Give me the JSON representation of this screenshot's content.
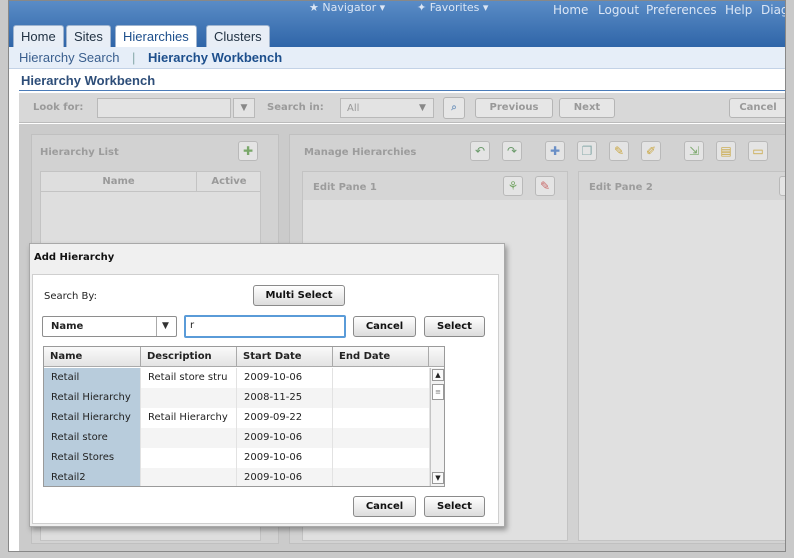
{
  "topbar": {
    "links": [
      "Navigator",
      "Favorites",
      "Home",
      "Logout",
      "Preferences",
      "Help",
      "Diag"
    ]
  },
  "tabs": [
    "Home",
    "Sites",
    "Hierarchies",
    "Clusters"
  ],
  "subnav": {
    "search_link": "Hierarchy Search",
    "separator": "|",
    "current": "Hierarchy Workbench"
  },
  "page_title": "Hierarchy Workbench",
  "toolbar": {
    "look_for_label": "Look for:",
    "look_for_value": "",
    "search_in_label": "Search in:",
    "search_in_value": "All",
    "previous": "Previous",
    "next": "Next",
    "cancel": "Cancel"
  },
  "hierarchy_list": {
    "title": "Hierarchy List",
    "columns": [
      "Name",
      "Active"
    ]
  },
  "manage": {
    "title": "Manage Hierarchies",
    "edit_pane_1": "Edit Pane 1",
    "edit_pane_2": "Edit Pane 2"
  },
  "dialog": {
    "title": "Add Hierarchy",
    "search_by_label": "Search By:",
    "multi_select": "Multi Select",
    "search_by_value": "Name",
    "search_text": "r",
    "cancel": "Cancel",
    "select": "Select",
    "columns": [
      "Name",
      "Description",
      "Start Date",
      "End Date"
    ],
    "rows": [
      {
        "name": "Retail",
        "description": "Retail store stru",
        "start": "2009-10-06",
        "end": ""
      },
      {
        "name": "Retail Hierarchy",
        "description": "",
        "start": "2008-11-25",
        "end": ""
      },
      {
        "name": "Retail Hierarchy",
        "description": "Retail Hierarchy",
        "start": "2009-09-22",
        "end": ""
      },
      {
        "name": "Retail store",
        "description": "",
        "start": "2009-10-06",
        "end": ""
      },
      {
        "name": "Retail Stores",
        "description": "",
        "start": "2009-10-06",
        "end": ""
      },
      {
        "name": "Retail2",
        "description": "",
        "start": "2009-10-06",
        "end": ""
      }
    ]
  },
  "colors": {
    "header_blue": "#2f65a8",
    "name_column": "#b8ccdc",
    "focus": "#5a9bd8"
  }
}
